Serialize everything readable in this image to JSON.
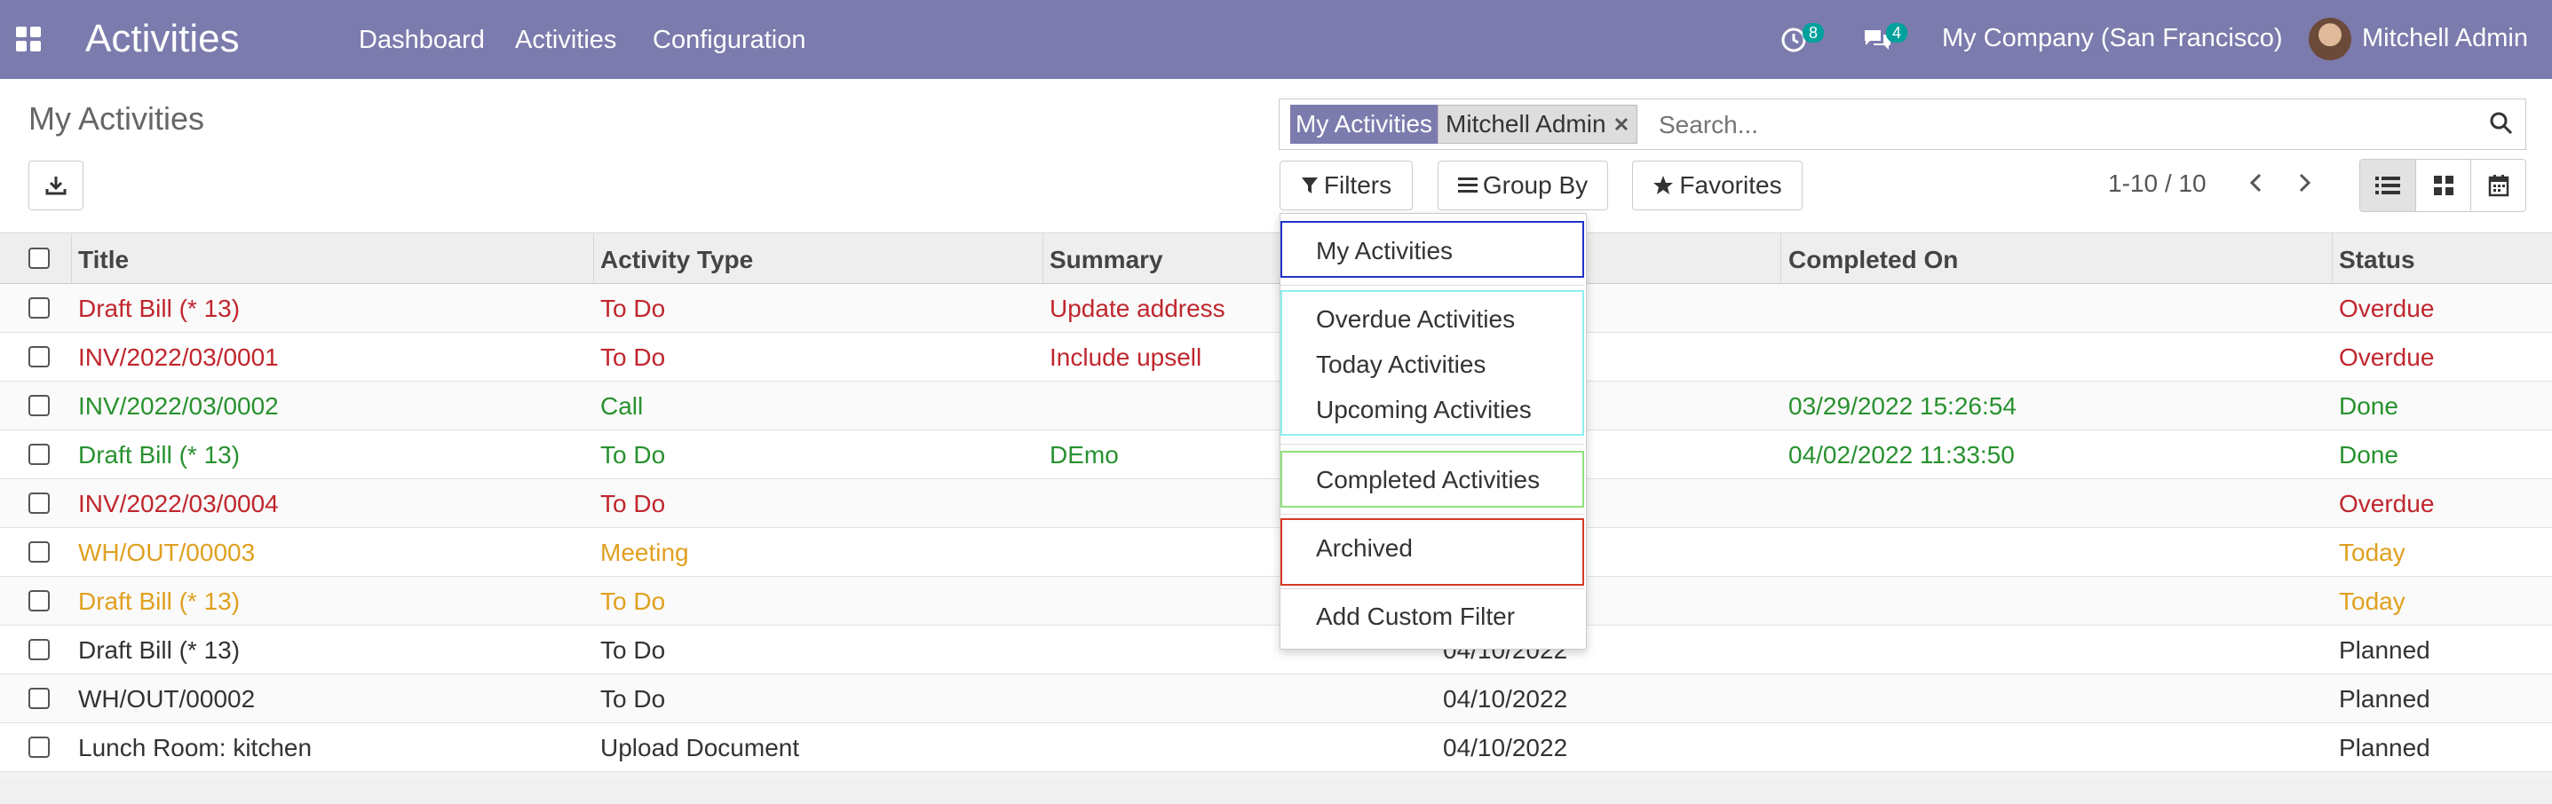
{
  "topbar": {
    "app_title": "Activities",
    "menu": [
      "Dashboard",
      "Activities",
      "Configuration"
    ],
    "activity_count": "8",
    "message_count": "4",
    "company": "My Company (San Francisco)",
    "user": "Mitchell Admin",
    "color": "#7c7bad"
  },
  "control_panel": {
    "page_title": "My Activities",
    "search": {
      "facet_label": "My Activities",
      "facet_value": "Mitchell Admin",
      "placeholder": "Search..."
    },
    "filters_label": "Filters",
    "group_by_label": "Group By",
    "favorites_label": "Favorites",
    "pager": "1-10 / 10"
  },
  "table": {
    "columns": [
      "Title",
      "Activity Type",
      "Summary",
      "Completed On",
      "Status"
    ],
    "rows": [
      {
        "title": "Draft Bill (* 13)",
        "type": "To Do",
        "summary": "Update address",
        "date": "",
        "completed": "",
        "status": "Overdue",
        "state": "overdue"
      },
      {
        "title": "INV/2022/03/0001",
        "type": "To Do",
        "summary": "Include upsell",
        "date": "",
        "completed": "",
        "status": "Overdue",
        "state": "overdue"
      },
      {
        "title": "INV/2022/03/0002",
        "type": "Call",
        "summary": "",
        "date": "",
        "completed": "03/29/2022 15:26:54",
        "status": "Done",
        "state": "done"
      },
      {
        "title": "Draft Bill (* 13)",
        "type": "To Do",
        "summary": "DEmo",
        "date": "",
        "completed": "04/02/2022 11:33:50",
        "status": "Done",
        "state": "done"
      },
      {
        "title": "INV/2022/03/0004",
        "type": "To Do",
        "summary": "",
        "date": "",
        "completed": "",
        "status": "Overdue",
        "state": "overdue"
      },
      {
        "title": "WH/OUT/00003",
        "type": "Meeting",
        "summary": "",
        "date": "",
        "completed": "",
        "status": "Today",
        "state": "today"
      },
      {
        "title": "Draft Bill (* 13)",
        "type": "To Do",
        "summary": "",
        "date": "",
        "completed": "",
        "status": "Today",
        "state": "today"
      },
      {
        "title": "Draft Bill (* 13)",
        "type": "To Do",
        "summary": "",
        "date": "04/10/2022",
        "completed": "",
        "status": "Planned",
        "state": "planned"
      },
      {
        "title": "WH/OUT/00002",
        "type": "To Do",
        "summary": "",
        "date": "04/10/2022",
        "completed": "",
        "status": "Planned",
        "state": "planned"
      },
      {
        "title": "Lunch Room: kitchen",
        "type": "Upload Document",
        "summary": "",
        "date": "04/10/2022",
        "completed": "",
        "status": "Planned",
        "state": "planned"
      }
    ]
  },
  "filters_dropdown": {
    "items": [
      "My Activities",
      "Overdue Activities",
      "Today Activities",
      "Upcoming Activities",
      "Completed Activities",
      "Archived",
      "Add Custom Filter"
    ]
  },
  "colors": {
    "overdue": "#c0262d",
    "done": "#28912f",
    "today": "#e0a020",
    "planned": "#333333"
  }
}
